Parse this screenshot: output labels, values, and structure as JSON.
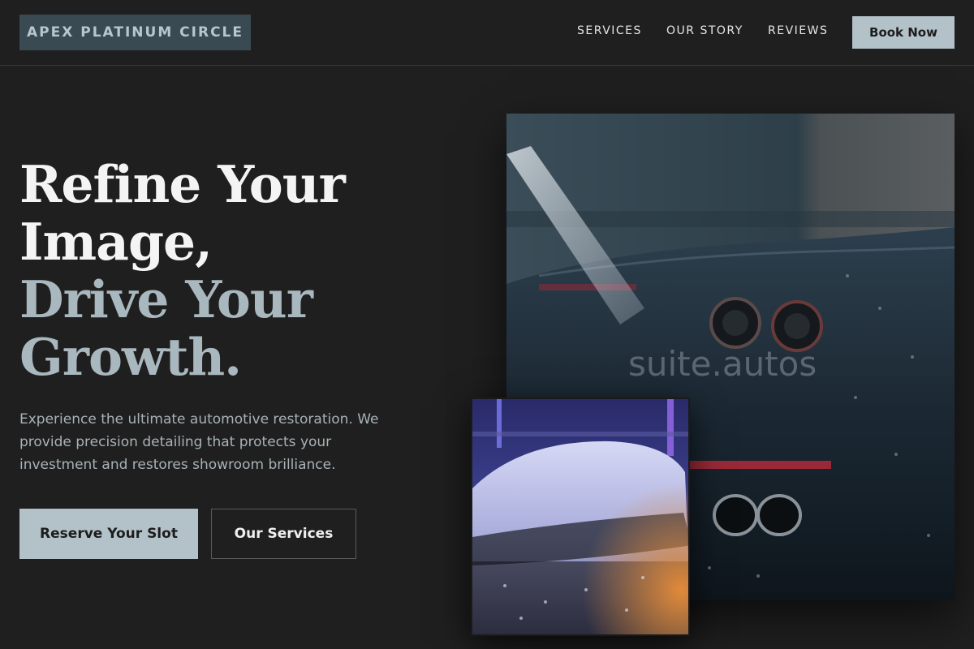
{
  "header": {
    "brand": "APEX PLATINUM CIRCLE",
    "nav": [
      "SERVICES",
      "OUR STORY",
      "REVIEWS"
    ],
    "cta": "Book Now"
  },
  "hero": {
    "title_line1": "Refine Your",
    "title_line2": "Image,",
    "title_line3": "Drive Your",
    "title_line4": "Growth.",
    "subtitle": "Experience the ultimate automotive restoration. We provide precision detailing that protects your investment and restores showroom brilliance.",
    "primary_button": "Reserve Your Slot",
    "secondary_button": "Our Services"
  },
  "images": {
    "main_watermark": "suite.autos"
  },
  "colors": {
    "background": "#1f1f1f",
    "brand_bg": "#3a4a52",
    "accent": "#b3c1c8",
    "title_accent": "#a9b7be"
  }
}
